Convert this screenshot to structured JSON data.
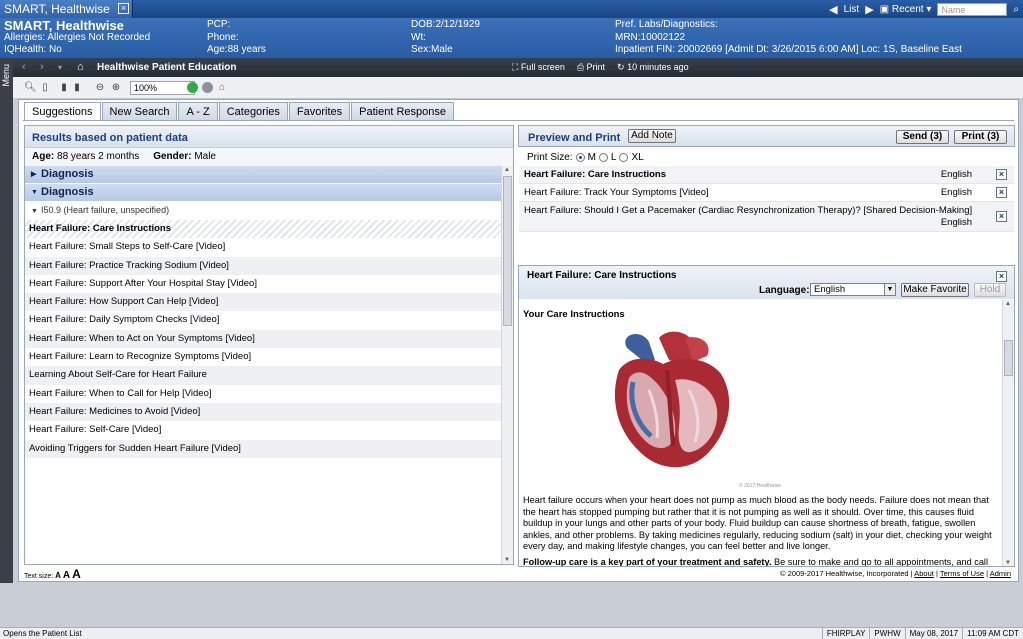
{
  "window": {
    "tab_title": "SMART, Healthwise",
    "list_label": "List",
    "recent_label": "Recent",
    "name_placeholder": "Name"
  },
  "banner": {
    "patient_name": "SMART, Healthwise",
    "allergies": "Allergies: Allergies Not Recorded",
    "iqhealth": "IQHealth: No",
    "pcp": "PCP:",
    "phone": "Phone:",
    "age": "Age:88 years",
    "dob": "DOB:2/12/1929",
    "wt": "Wt:",
    "sex": "Sex:Male",
    "pref_labs": "Pref. Labs/Diagnostics:",
    "mrn": "MRN:10002122",
    "inpatient": "Inpatient  FIN: 20002669 [Admit Dt: 3/26/2015 6:00 AM] Loc: 1S, Baseline East"
  },
  "menu_label": "Menu",
  "nav": {
    "page_title": "Healthwise Patient Education",
    "full_screen": "Full screen",
    "print": "Print",
    "updated": "10 minutes ago"
  },
  "toolbar": {
    "zoom": "100%"
  },
  "tabs": [
    "Suggestions",
    "New Search",
    "A - Z",
    "Categories",
    "Favorites",
    "Patient Response"
  ],
  "left_pane": {
    "header": "Results based on patient data",
    "age_label": "Age:",
    "age_value": "88 years 2 months",
    "gender_label": "Gender:",
    "gender_value": "Male",
    "diagnosis_1": "Diagnosis",
    "diagnosis_2": "Diagnosis",
    "code": "I50.9 (Heart failure, unspecified)",
    "items": [
      "Heart Failure: Care Instructions",
      "Heart Failure: Small Steps to Self-Care [Video]",
      "Heart Failure: Practice Tracking Sodium [Video]",
      "Heart Failure: Support After Your Hospital Stay [Video]",
      "Heart Failure: How Support Can Help [Video]",
      "Heart Failure: Daily Symptom Checks [Video]",
      "Heart Failure: When to Act on Your Symptoms [Video]",
      "Heart Failure: Learn to Recognize Symptoms [Video]",
      "Learning About Self-Care for Heart Failure",
      "Heart Failure: When to Call for Help [Video]",
      "Heart Failure: Medicines to Avoid [Video]",
      "Heart Failure: Self-Care [Video]",
      "Avoiding Triggers for Sudden Heart Failure [Video]"
    ],
    "text_size_label": "Text size:",
    "text_size_glyph": "A"
  },
  "right_pane": {
    "header": "Preview and Print",
    "add_note": "Add Note",
    "send": "Send (3)",
    "print": "Print (3)",
    "print_size_label": "Print Size:",
    "sizes": [
      "M",
      "L",
      "XL"
    ],
    "selected_size": "M",
    "print_list": [
      {
        "name": "Heart Failure: Care Instructions",
        "language": "English"
      },
      {
        "name": "Heart Failure: Track Your Symptoms [Video]",
        "language": "English"
      },
      {
        "name": "Heart Failure: Should I Get a Pacemaker (Cardiac Resynchronization Therapy)? [Shared Decision-Making]",
        "language": "English"
      }
    ],
    "doc": {
      "title": "Heart Failure: Care Instructions",
      "language_label": "Language:",
      "language_value": "English",
      "make_favorite": "Make Favorite",
      "hold": "Hold",
      "heading": "Your Care Instructions",
      "image_credit": "© 2017 Healthwise",
      "para1": "Heart failure occurs when your heart does not pump as much blood as the body needs. Failure does not mean that the heart has stopped pumping but rather that it is not pumping as well as it should. Over time, this causes fluid buildup in your lungs and other parts of your body. Fluid buildup can cause shortness of breath, fatigue, swollen ankles, and other problems. By taking medicines regularly, reducing sodium (salt) in your diet, checking your weight every day, and making lifestyle changes, you can feel better and live longer.",
      "para2_bold": "Follow-up care is a key part of your treatment and safety.",
      "para2": " Be sure to make and go to all appointments, and call your doctor if you are having problems. It's also a good idea to know your test results and keep a list of the medicines you take."
    },
    "copyright": "© 2009-2017 Healthwise, Incorporated",
    "about": "About",
    "terms": "Terms of Use",
    "admin": "Admin"
  },
  "statusbar": {
    "message": "Opens the Patient List",
    "user": "FHIRPLAY",
    "app": "PWHW",
    "date": "May 08, 2017",
    "time": "11:09 AM CDT"
  }
}
